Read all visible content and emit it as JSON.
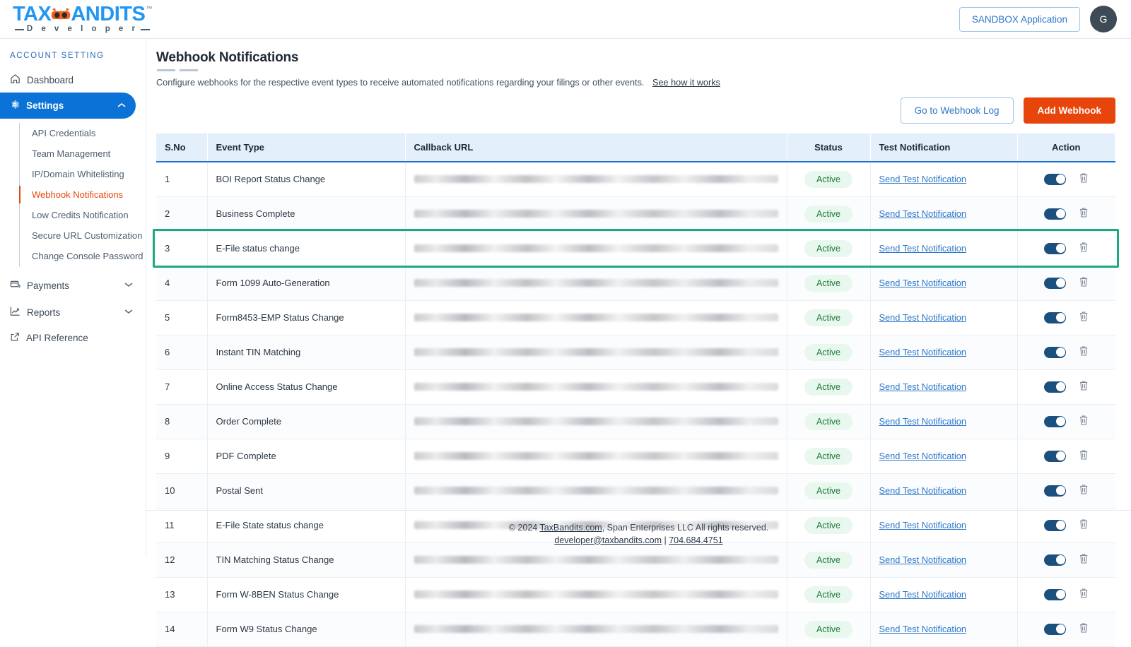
{
  "header": {
    "logo": {
      "tax": "TAX",
      "bandits": "ANDITS",
      "tm": "™",
      "developer": "D e v e l o p e r"
    },
    "sandbox_button": "SANDBOX Application",
    "avatar_initial": "G"
  },
  "sidebar": {
    "section_label": "ACCOUNT SETTING",
    "dashboard": "Dashboard",
    "settings": "Settings",
    "settings_subitems": [
      "API Credentials",
      "Team Management",
      "IP/Domain Whitelisting",
      "Webhook Notifications",
      "Low Credits Notification",
      "Secure URL Customization",
      "Change Console Password"
    ],
    "selected_subitem": "Webhook Notifications",
    "payments": "Payments",
    "reports": "Reports",
    "api_reference": "API Reference"
  },
  "main": {
    "title": "Webhook Notifications",
    "description": "Configure webhooks for the respective event types to receive automated notifications regarding your filings or other events.",
    "see_how_link": "See how it works",
    "go_to_log_button": "Go to Webhook Log",
    "add_webhook_button": "Add Webhook"
  },
  "table": {
    "columns": [
      "S.No",
      "Event Type",
      "Callback URL",
      "Status",
      "Test Notification",
      "Action"
    ],
    "rows": [
      {
        "sno": "1",
        "event": "BOI Report Status Change",
        "url": "",
        "status": "Active",
        "test": "Send Test Notification",
        "enabled": true,
        "highlighted": false
      },
      {
        "sno": "2",
        "event": "Business Complete",
        "url": "",
        "status": "Active",
        "test": "Send Test Notification",
        "enabled": true,
        "highlighted": false
      },
      {
        "sno": "3",
        "event": "E-File status change",
        "url": "",
        "status": "Active",
        "test": "Send Test Notification",
        "enabled": true,
        "highlighted": true
      },
      {
        "sno": "4",
        "event": "Form 1099 Auto-Generation",
        "url": "",
        "status": "Active",
        "test": "Send Test Notification",
        "enabled": true,
        "highlighted": false
      },
      {
        "sno": "5",
        "event": "Form8453-EMP Status Change",
        "url": "",
        "status": "Active",
        "test": "Send Test Notification",
        "enabled": true,
        "highlighted": false
      },
      {
        "sno": "6",
        "event": "Instant TIN Matching",
        "url": "",
        "status": "Active",
        "test": "Send Test Notification",
        "enabled": true,
        "highlighted": false
      },
      {
        "sno": "7",
        "event": "Online Access Status Change",
        "url": "",
        "status": "Active",
        "test": "Send Test Notification",
        "enabled": true,
        "highlighted": false
      },
      {
        "sno": "8",
        "event": "Order Complete",
        "url": "",
        "status": "Active",
        "test": "Send Test Notification",
        "enabled": true,
        "highlighted": false
      },
      {
        "sno": "9",
        "event": "PDF Complete",
        "url": "",
        "status": "Active",
        "test": "Send Test Notification",
        "enabled": true,
        "highlighted": false
      },
      {
        "sno": "10",
        "event": "Postal Sent",
        "url": "",
        "status": "Active",
        "test": "Send Test Notification",
        "enabled": true,
        "highlighted": false
      },
      {
        "sno": "11",
        "event": "E-File State status change",
        "url": "",
        "status": "Active",
        "test": "Send Test Notification",
        "enabled": true,
        "highlighted": false
      },
      {
        "sno": "12",
        "event": "TIN Matching Status Change",
        "url": "",
        "status": "Active",
        "test": "Send Test Notification",
        "enabled": true,
        "highlighted": false
      },
      {
        "sno": "13",
        "event": "Form W-8BEN Status Change",
        "url": "",
        "status": "Active",
        "test": "Send Test Notification",
        "enabled": true,
        "highlighted": false
      },
      {
        "sno": "14",
        "event": "Form W9 Status Change",
        "url": "",
        "status": "Active",
        "test": "Send Test Notification",
        "enabled": true,
        "highlighted": false
      }
    ]
  },
  "footer": {
    "copyright_pre": "© 2024 ",
    "site_link": "TaxBandits.com",
    "copyright_post": ", Span Enterprises LLC All rights reserved.",
    "email": "developer@taxbandits.com",
    "separator": " | ",
    "phone": "704.684.4751"
  },
  "colors": {
    "brand_blue": "#2196f3",
    "accent_orange": "#e8450c",
    "nav_active_blue": "#0b72d8",
    "highlight_green": "#1ca883",
    "status_green": "#1f7a3c",
    "toggle_navy": "#1b4f7e"
  }
}
